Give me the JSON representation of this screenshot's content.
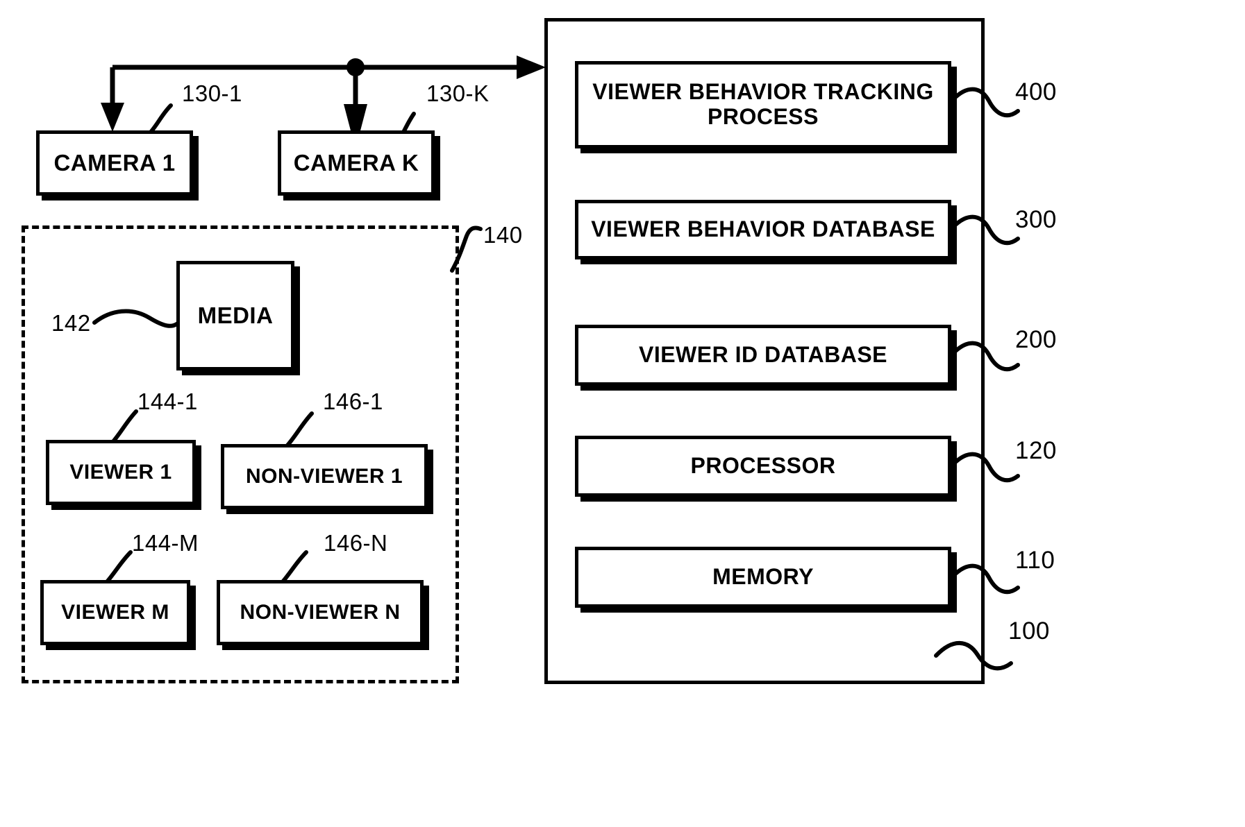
{
  "figure": {
    "type": "patent-block-diagram",
    "background_color": "#ffffff",
    "line_color": "#000000"
  },
  "cameras": [
    {
      "label": "CAMERA 1",
      "ref": "130-1"
    },
    {
      "label": "CAMERA K",
      "ref": "130-K"
    }
  ],
  "media_environment": {
    "ref": "140",
    "media": {
      "label": "MEDIA",
      "ref": "142"
    },
    "viewers": [
      {
        "label": "VIEWER 1",
        "ref": "144-1"
      },
      {
        "label": "VIEWER M",
        "ref": "144-M"
      }
    ],
    "non_viewers": [
      {
        "label": "NON-VIEWER 1",
        "ref": "146-1"
      },
      {
        "label": "NON-VIEWER N",
        "ref": "146-N"
      }
    ]
  },
  "system": {
    "ref": "100",
    "modules": [
      {
        "label": "VIEWER BEHAVIOR TRACKING PROCESS",
        "ref": "400"
      },
      {
        "label": "VIEWER BEHAVIOR DATABASE",
        "ref": "300"
      },
      {
        "label": "VIEWER ID DATABASE",
        "ref": "200"
      },
      {
        "label": "PROCESSOR",
        "ref": "120"
      },
      {
        "label": "MEMORY",
        "ref": "110"
      }
    ]
  }
}
